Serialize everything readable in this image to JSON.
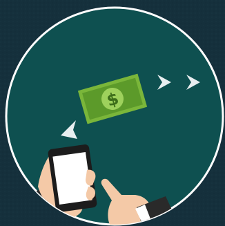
{
  "illustration": {
    "bill": {
      "symbol": "$"
    },
    "icons": {
      "bill": "dollar-bill-icon",
      "arrows": "chevron-right-icon",
      "phone": "smartphone-icon",
      "hands": "hand-icon"
    },
    "colors": {
      "background": "#15303c",
      "circle_fill": "#0e5050",
      "circle_stroke": "#ffffff",
      "bill_outer": "#7ab63a",
      "bill_inner": "#5c9a2a",
      "coin": "#9ed15c",
      "arrow": "#e8eef0",
      "phone_body": "#1c1c1c",
      "phone_screen": "#ffffff",
      "skin": "#f4c9a7",
      "sleeve": "#2a2a2a"
    }
  }
}
